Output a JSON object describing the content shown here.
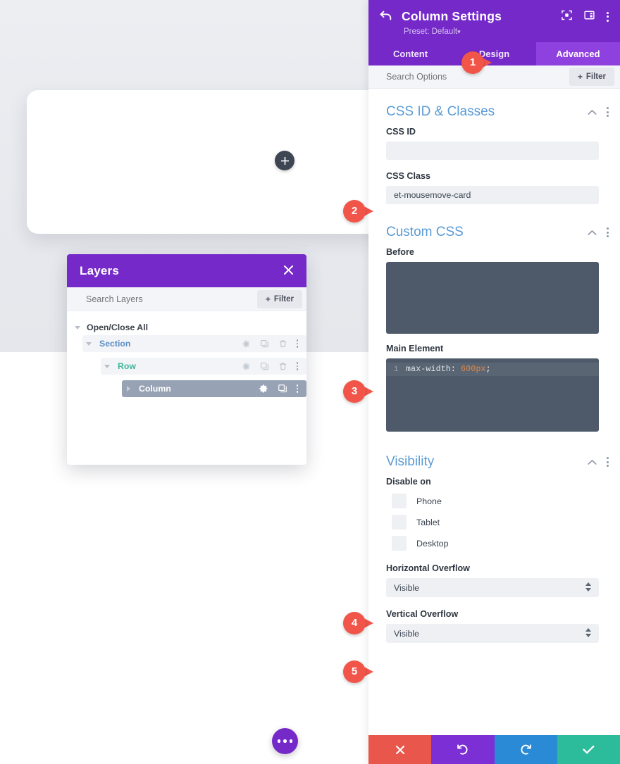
{
  "canvas": {
    "add_module_icon": "plus-icon",
    "fab_icon": "ellipsis-icon"
  },
  "layers_panel": {
    "title": "Layers",
    "close_icon": "close-icon",
    "search_placeholder": "Search Layers",
    "filter_label": "Filter",
    "filter_icon": "plus-icon",
    "open_close_all": "Open/Close All",
    "rows": [
      {
        "label": "Section",
        "color": "#5b8ec4",
        "toggle_icon": "caret-down-icon",
        "actions": [
          "gear-icon",
          "duplicate-icon",
          "trash-icon",
          "ellipsis-vertical-icon"
        ]
      },
      {
        "label": "Row",
        "color": "#3fb79a",
        "toggle_icon": "caret-down-icon",
        "actions": [
          "gear-icon",
          "duplicate-icon",
          "trash-icon",
          "ellipsis-vertical-icon"
        ]
      },
      {
        "label": "Column",
        "color": "#ffffff",
        "toggle_icon": "caret-right-icon",
        "actions": [
          "gear-icon",
          "duplicate-icon",
          "ellipsis-vertical-icon"
        ]
      }
    ]
  },
  "settings_panel": {
    "back_icon": "back-arrow-icon",
    "title": "Column Settings",
    "preset": "Preset: Default",
    "preset_caret": "▾",
    "header_icons": [
      "focus-target-icon",
      "panel-layout-icon",
      "ellipsis-vertical-icon"
    ],
    "tabs": [
      {
        "label": "Content",
        "active": false
      },
      {
        "label": "Design",
        "active": false
      },
      {
        "label": "Advanced",
        "active": true
      }
    ],
    "search_placeholder": "Search Options",
    "filter_label": "Filter",
    "filter_icon": "plus-icon",
    "sections": {
      "css_id_classes": {
        "title": "CSS ID & Classes",
        "collapse_icon": "chevron-up-icon",
        "menu_icon": "ellipsis-vertical-icon",
        "css_id_label": "CSS ID",
        "css_id_value": "",
        "css_class_label": "CSS Class",
        "css_class_value": "et-mousemove-card"
      },
      "custom_css": {
        "title": "Custom CSS",
        "collapse_icon": "chevron-up-icon",
        "menu_icon": "ellipsis-vertical-icon",
        "before_label": "Before",
        "before_value": "",
        "main_element_label": "Main Element",
        "main_element_line_number": "1",
        "main_element_property": "max-width",
        "main_element_colon": ":",
        "main_element_value": "600px",
        "main_element_semicolon": ";"
      },
      "visibility": {
        "title": "Visibility",
        "collapse_icon": "chevron-up-icon",
        "menu_icon": "ellipsis-vertical-icon",
        "disable_on_label": "Disable on",
        "checkboxes": [
          {
            "label": "Phone",
            "checked": false
          },
          {
            "label": "Tablet",
            "checked": false
          },
          {
            "label": "Desktop",
            "checked": false
          }
        ],
        "horizontal_overflow_label": "Horizontal Overflow",
        "horizontal_overflow_value": "Visible",
        "vertical_overflow_label": "Vertical Overflow",
        "vertical_overflow_value": "Visible"
      }
    },
    "actions": [
      {
        "name": "discard",
        "icon": "close-icon",
        "color": "#e9564c"
      },
      {
        "name": "undo",
        "icon": "undo-icon",
        "color": "#7b2fd4"
      },
      {
        "name": "redo",
        "icon": "redo-icon",
        "color": "#2a8ad6"
      },
      {
        "name": "save",
        "icon": "checkmark-icon",
        "color": "#2cbb9b"
      }
    ]
  },
  "callouts": [
    {
      "number": "1"
    },
    {
      "number": "2"
    },
    {
      "number": "3"
    },
    {
      "number": "4"
    },
    {
      "number": "5"
    }
  ],
  "colors": {
    "brand_purple": "#7529c9",
    "tab_active_purple": "#8f41df",
    "heading_blue": "#5b9bd5",
    "code_bg": "#4e5a6a",
    "callout_red": "#f1554a"
  }
}
